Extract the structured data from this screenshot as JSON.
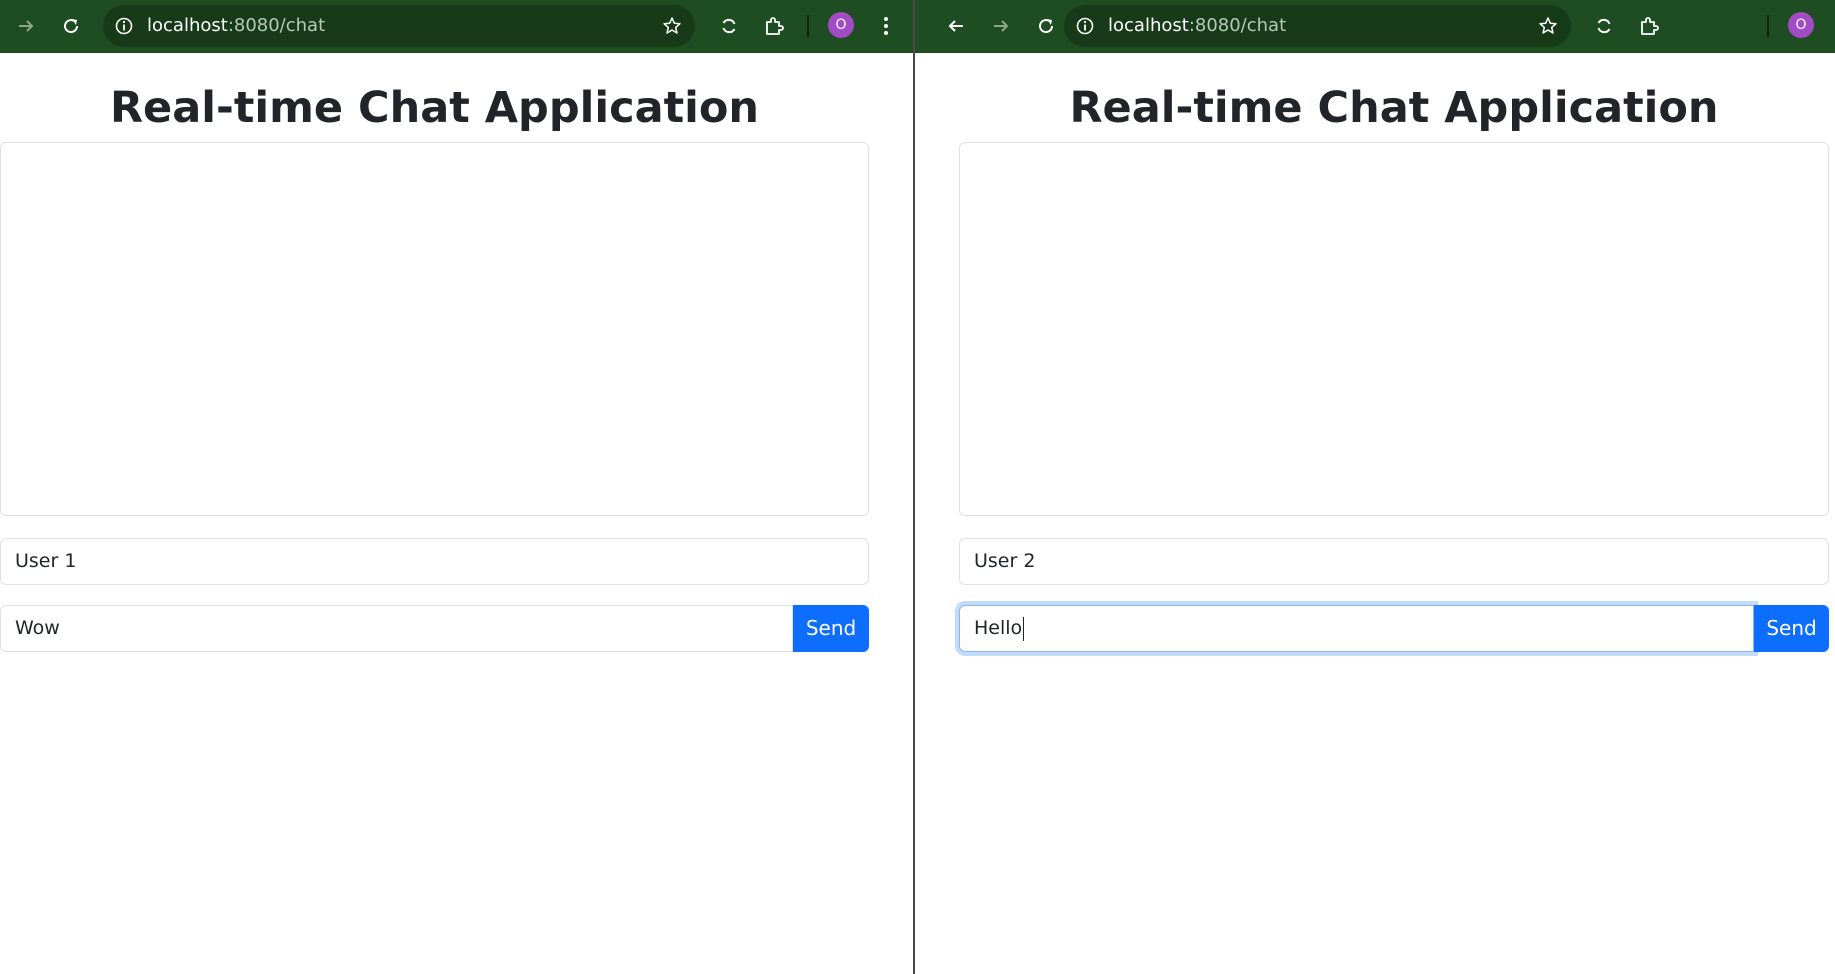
{
  "browser": {
    "left": {
      "url_host": "localhost",
      "url_path": ":8080/chat",
      "profile_initial": "O"
    },
    "right": {
      "url_host": "localhost",
      "url_path": ":8080/chat",
      "profile_initial": "O"
    }
  },
  "page": {
    "title": "Real-time Chat Application",
    "send_label": "Send"
  },
  "left_window": {
    "username_value": "User 1",
    "message_value": "Wow"
  },
  "right_window": {
    "username_value": "User 2",
    "message_value": "Hello"
  },
  "colors": {
    "toolbar": "#1f4d22",
    "omnibox": "#173a19",
    "send_button": "#0d6efd",
    "avatar": "#a14bc4",
    "focus_ring": "#86b7fe"
  }
}
